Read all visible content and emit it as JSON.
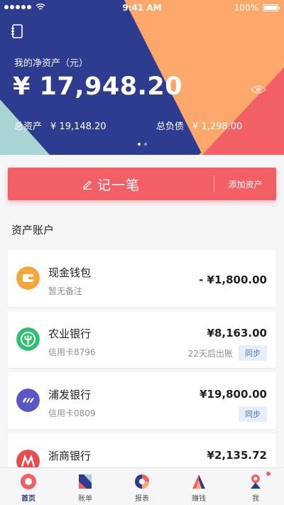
{
  "status_bar": {
    "time": "9:41 AM",
    "battery": "100%"
  },
  "hero": {
    "label": "我的净资产（元）",
    "net_assets": "¥ 17,948.20",
    "total_assets_label": "总资产",
    "total_assets": "¥ 19,148.20",
    "total_liabilities_label": "总负债",
    "total_liabilities": "¥ 1,298.00",
    "pager_pages": 2,
    "pager_active": 1
  },
  "actions": {
    "record": "记一笔",
    "add_asset": "添加资产"
  },
  "section": {
    "title": "资产账户"
  },
  "accounts": [
    {
      "name": "现金钱包",
      "sub": "暂无备注",
      "amount": "- ¥1,800.00",
      "icon": "wallet-icon",
      "color": "#f5a53b"
    },
    {
      "name": "农业银行",
      "sub": "信用卡8796",
      "amount": "¥8,163.00",
      "note": "22天后出账",
      "sync": "同步",
      "icon": "abc-bank-icon",
      "color": "#2fbf71"
    },
    {
      "name": "浦发银行",
      "sub": "信用卡0809",
      "amount": "¥19,800.00",
      "sync": "同步",
      "icon": "spdb-bank-icon",
      "color": "#5a56c6"
    },
    {
      "name": "浙商银行",
      "amount": "¥2,135.72",
      "icon": "czb-bank-icon",
      "color": "#e84c4c"
    }
  ],
  "tabs": [
    {
      "label": "首页",
      "icon": "home-icon",
      "active": true
    },
    {
      "label": "账单",
      "icon": "bill-icon"
    },
    {
      "label": "报表",
      "icon": "report-icon"
    },
    {
      "label": "赚钱",
      "icon": "earn-icon"
    },
    {
      "label": "我",
      "icon": "profile-icon",
      "badge": true
    }
  ],
  "colors": {
    "hero_blue": "#2d3c8e",
    "accent_red": "#f26065",
    "orange": "#fca76b",
    "teal": "#a8d5d3",
    "sync_blue": "#4a79c5"
  }
}
